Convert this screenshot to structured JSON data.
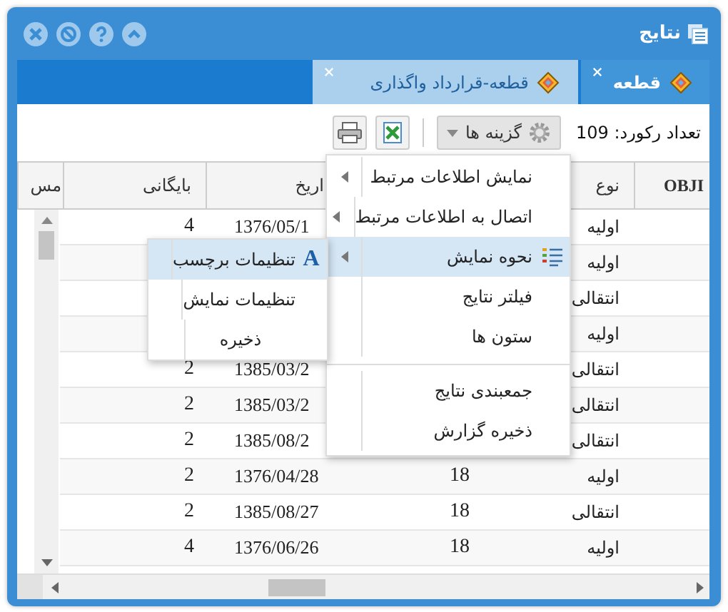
{
  "window": {
    "title": "نتایج"
  },
  "tabs": [
    {
      "label": "قطعه",
      "selected": false
    },
    {
      "label": "قطعه-قرارداد واگذاری",
      "selected": true
    }
  ],
  "toolbar": {
    "record_count_label": "تعداد رکورد:",
    "record_count": "109",
    "options_button": "گزینه ها"
  },
  "table": {
    "columns": [
      {
        "label": "OBJI"
      },
      {
        "label": "نوع"
      },
      {},
      {
        "label": "اریخ"
      },
      {
        "label": "بایگانی"
      },
      {
        "label": "مس"
      }
    ],
    "rows": [
      {
        "cells": [
          null,
          "اولیه",
          null,
          "1376/05/1",
          "4",
          null
        ]
      },
      {
        "cells": [
          null,
          "اولیه",
          null,
          null,
          null,
          null
        ]
      },
      {
        "cells": [
          null,
          "انتقالی",
          null,
          null,
          null,
          null
        ]
      },
      {
        "cells": [
          null,
          "اولیه",
          null,
          null,
          null,
          null
        ]
      },
      {
        "cells": [
          null,
          "انتقالی",
          null,
          "1385/03/2",
          "2",
          null
        ]
      },
      {
        "cells": [
          null,
          "انتقالی",
          null,
          "1385/03/2",
          "2",
          null
        ]
      },
      {
        "cells": [
          null,
          "انتقالی",
          null,
          "1385/08/2",
          "2",
          null
        ]
      },
      {
        "cells": [
          null,
          "اولیه",
          "18",
          "1376/04/28",
          "2",
          null
        ]
      },
      {
        "cells": [
          null,
          "انتقالی",
          "18",
          "1385/08/27",
          "2",
          null
        ]
      },
      {
        "cells": [
          null,
          "اولیه",
          "18",
          "1376/06/26",
          "4",
          null
        ]
      }
    ]
  },
  "menu": {
    "items": [
      {
        "kind": "item",
        "label": "نمایش اطلاعات مرتبط",
        "has_submenu": true,
        "has_icon": false,
        "selected": false
      },
      {
        "kind": "item",
        "label": "اتصال به اطلاعات مرتبط",
        "has_submenu": true,
        "has_icon": false,
        "selected": false
      },
      {
        "kind": "item",
        "label": "نحوه نمایش",
        "has_submenu": true,
        "has_icon": true,
        "selected": true
      },
      {
        "kind": "item",
        "label": "فیلتر نتایج",
        "has_submenu": false,
        "has_icon": false,
        "selected": false
      },
      {
        "kind": "item",
        "label": "ستون ها",
        "has_submenu": false,
        "has_icon": false,
        "selected": false
      },
      {
        "kind": "separator"
      },
      {
        "kind": "item",
        "label": "جمعبندی نتایج",
        "has_submenu": false,
        "has_icon": false,
        "selected": false
      },
      {
        "kind": "item",
        "label": "ذخیره گزارش",
        "has_submenu": false,
        "has_icon": false,
        "selected": false
      }
    ]
  },
  "submenu": {
    "items": [
      {
        "label": "تنظیمات برچسب",
        "icon_text": "A",
        "selected": true
      },
      {
        "label": "تنظیمات نمایش",
        "selected": false
      },
      {
        "label": "ذخیره",
        "selected": false
      }
    ]
  }
}
